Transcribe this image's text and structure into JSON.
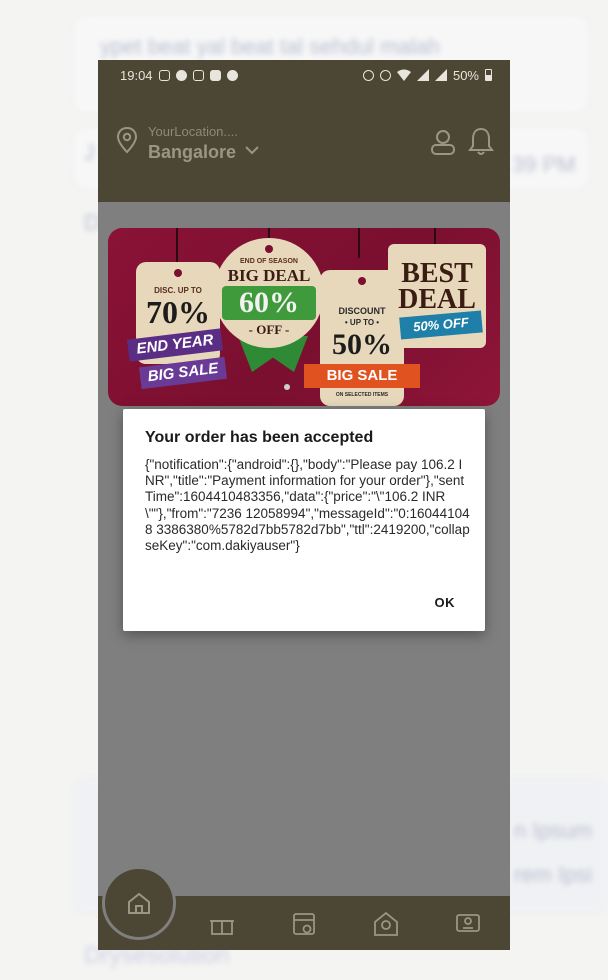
{
  "background": {
    "fragments": [
      "ypet beat yal beat tal sehdul malah"
    ],
    "time_fragment": "39 PM",
    "left_fragment_1": "J",
    "left_fragment_2": "D",
    "lorem_1": "n Ipsum",
    "lorem_2": "rem Ipsi",
    "footer_brand": "Drysesolution"
  },
  "status_bar": {
    "time": "19:04",
    "battery": "50%"
  },
  "header": {
    "location_label": "YourLocation....",
    "city": "Bangalore"
  },
  "banner": {
    "tag1_top": "DISC. UP TO",
    "tag1_value": "70%",
    "tag1_ribbon1": "END YEAR",
    "tag1_ribbon2": "BIG SALE",
    "tag2_top": "END OF SEASON",
    "tag2_title": "BIG DEAL",
    "tag2_value": "60%",
    "tag2_sub": "- OFF -",
    "tag3_top": "DISCOUNT",
    "tag3_sub": "• UP TO •",
    "tag3_value": "50%",
    "tag3_ribbon": "BIG SALE",
    "tag3_foot": "ON SELECTED ITEMS",
    "tag4_line1": "BEST",
    "tag4_line2": "DEAL",
    "tag4_ribbon": "50% OFF"
  },
  "dialog": {
    "title": "Your order has been accepted",
    "body": "{\"notification\":{\"android\":{},\"body\":\"Please pay 106.2 INR\",\"title\":\"Payment information for your order\"},\"sentTime\":1604410483356,\"data\":{\"price\":\"\\\"106.2 INR\\\"\"},\"from\":\"7236 12058994\",\"messageId\":\"0:160441048 3386380%5782d7bb5782d7bb\",\"ttl\":2419200,\"collapseKey\":\"com.dakiyauser\"}",
    "ok_label": "OK"
  },
  "icons": {
    "location": "location-pin-icon",
    "chevron": "chevron-down-icon",
    "user": "user-icon",
    "bell": "bell-icon",
    "home": "home-icon",
    "gift": "gift-icon",
    "orders": "orders-icon",
    "delivery": "delivery-icon",
    "support": "support-icon"
  },
  "colors": {
    "header": "#4b4734",
    "overlay": "#7f7f7f",
    "banner": "#7a0f30"
  }
}
